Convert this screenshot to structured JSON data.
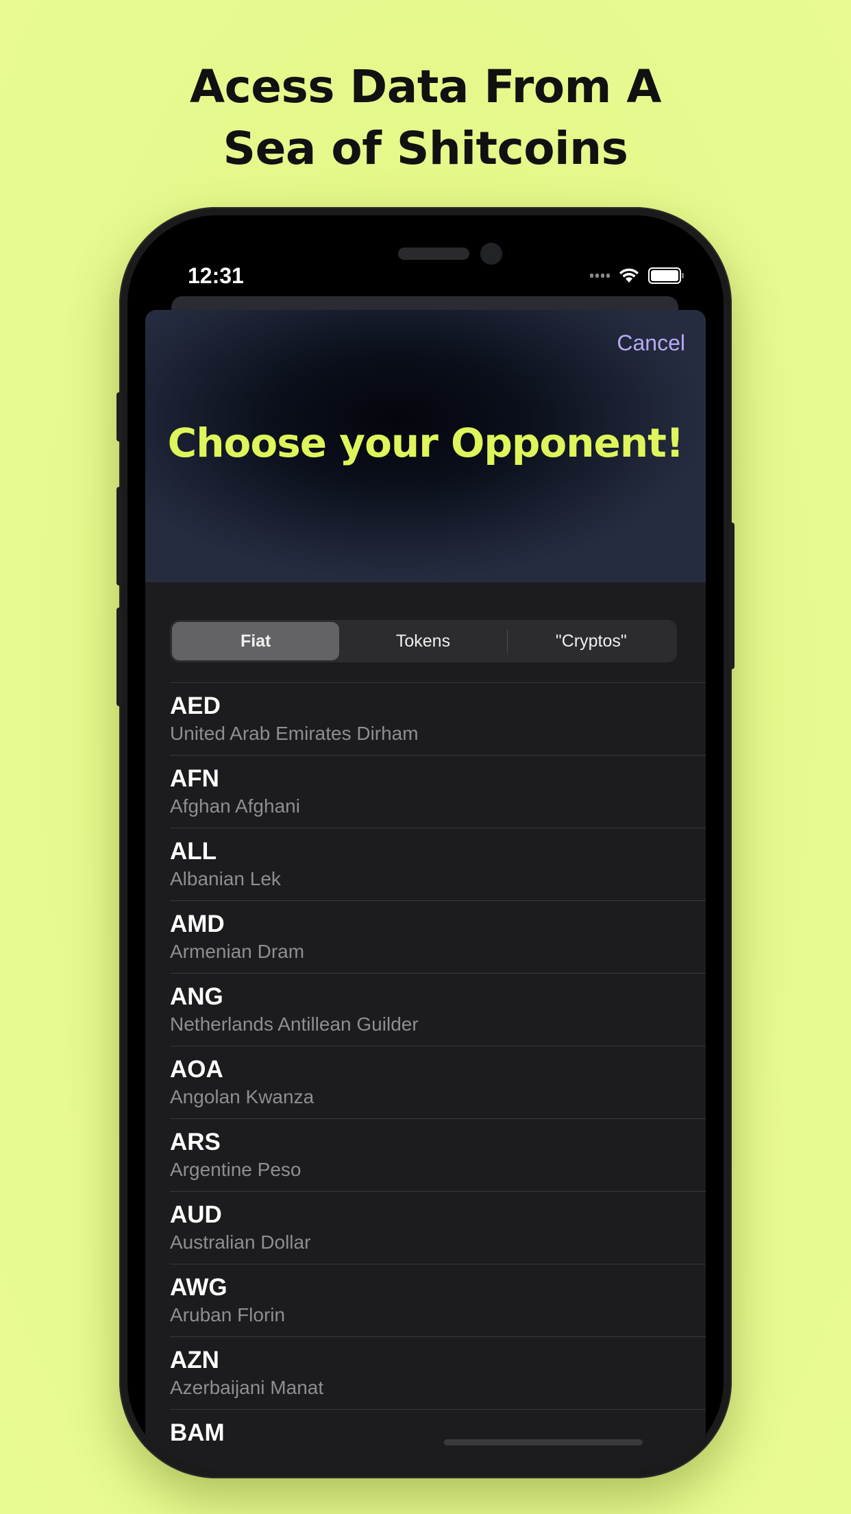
{
  "headline": {
    "line1": "Acess Data From A",
    "line2": "Sea of Shitcoins"
  },
  "status_bar": {
    "time": "12:31"
  },
  "header": {
    "cancel_label": "Cancel",
    "title": "Choose your Opponent!"
  },
  "segments": [
    {
      "label": "Fiat",
      "selected": true
    },
    {
      "label": "Tokens",
      "selected": false
    },
    {
      "label": "\"Cryptos\"",
      "selected": false
    }
  ],
  "currencies": [
    {
      "code": "AED",
      "name": "United Arab Emirates Dirham"
    },
    {
      "code": "AFN",
      "name": "Afghan Afghani"
    },
    {
      "code": "ALL",
      "name": "Albanian Lek"
    },
    {
      "code": "AMD",
      "name": "Armenian Dram"
    },
    {
      "code": "ANG",
      "name": "Netherlands Antillean Guilder"
    },
    {
      "code": "AOA",
      "name": "Angolan Kwanza"
    },
    {
      "code": "ARS",
      "name": "Argentine Peso"
    },
    {
      "code": "AUD",
      "name": "Australian Dollar"
    },
    {
      "code": "AWG",
      "name": "Aruban Florin"
    },
    {
      "code": "AZN",
      "name": "Azerbaijani Manat"
    },
    {
      "code": "BAM",
      "name": ""
    }
  ],
  "colors": {
    "background": "#e5f98c",
    "accent_title": "#def55b",
    "cancel": "#b9a9f3"
  }
}
